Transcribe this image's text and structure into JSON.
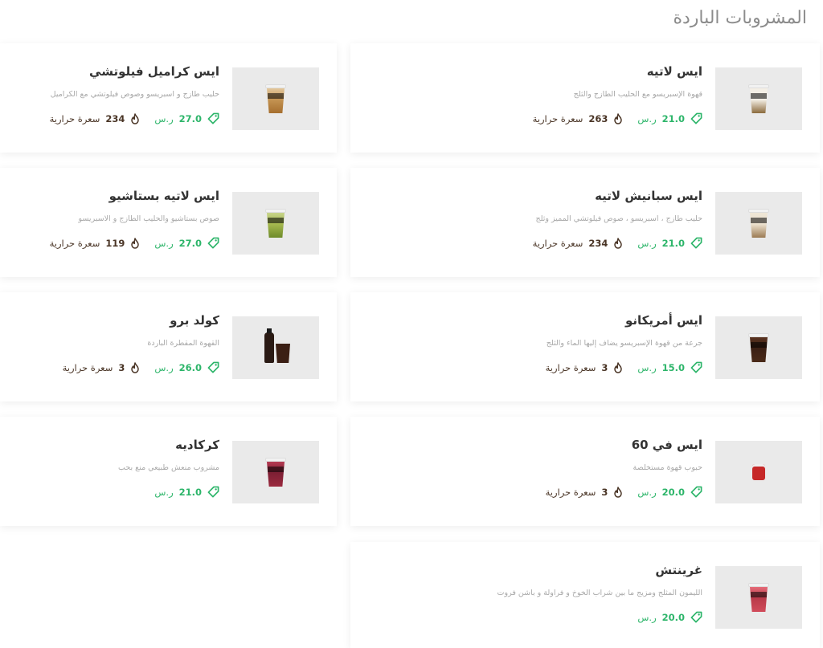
{
  "section_title": "المشروبات الباردة",
  "currency": "ر.س",
  "calories_label": "سعرة حرارية",
  "icons": {
    "price": "price-tag-icon",
    "calories": "flame-icon"
  },
  "colors": {
    "price": "#2db56a",
    "calories": "#4a3526",
    "title": "#8c8c8c"
  },
  "items": [
    {
      "name": "ايس لاتيه",
      "desc": "قهوة الإسبريسو مع الحليب الطازج والثلج",
      "price": "21.0",
      "calories": "263",
      "cup": "latte"
    },
    {
      "name": "ايس كراميل فيلوتشي",
      "desc": "حليب طازج و اسبريسو وصوص فيلوتشي مع الكراميل",
      "price": "27.0",
      "calories": "234",
      "cup": "caramel"
    },
    {
      "name": "ايس سبانيش لاتيه",
      "desc": "حليب طازج ، اسبريسو ، صوص فيلوتشي المميز وثلج",
      "price": "21.0",
      "calories": "234",
      "cup": "spanish"
    },
    {
      "name": "ايس لاتيه بستاشيو",
      "desc": "صوص بستاشيو والحليب الطازج و الاسبريسو",
      "price": "27.0",
      "calories": "119",
      "cup": "pistachio"
    },
    {
      "name": "ايس أمريكانو",
      "desc": "جرعة من قهوة الإسبريسو يضاف إليها الماء والثلج",
      "price": "15.0",
      "calories": "3",
      "cup": "americano"
    },
    {
      "name": "كولد برو",
      "desc": "القهوة المقطرة الباردة",
      "price": "26.0",
      "calories": "3",
      "cup": "coldbrew"
    },
    {
      "name": "ايس في 60",
      "desc": "حبوب قهوة مستخلصة",
      "price": "20.0",
      "calories": "3",
      "cup": "v60"
    },
    {
      "name": "كركاديه",
      "desc": "مشروب منعش طبيعي منع بحب",
      "price": "21.0",
      "calories": "",
      "cup": "karkade"
    },
    {
      "name": "غرينتش",
      "desc": "الليمون المثلج ومزيج ما بين شراب الخوخ و فراولة و باشن فروت",
      "price": "20.0",
      "calories": "",
      "cup": "greenwich"
    }
  ]
}
